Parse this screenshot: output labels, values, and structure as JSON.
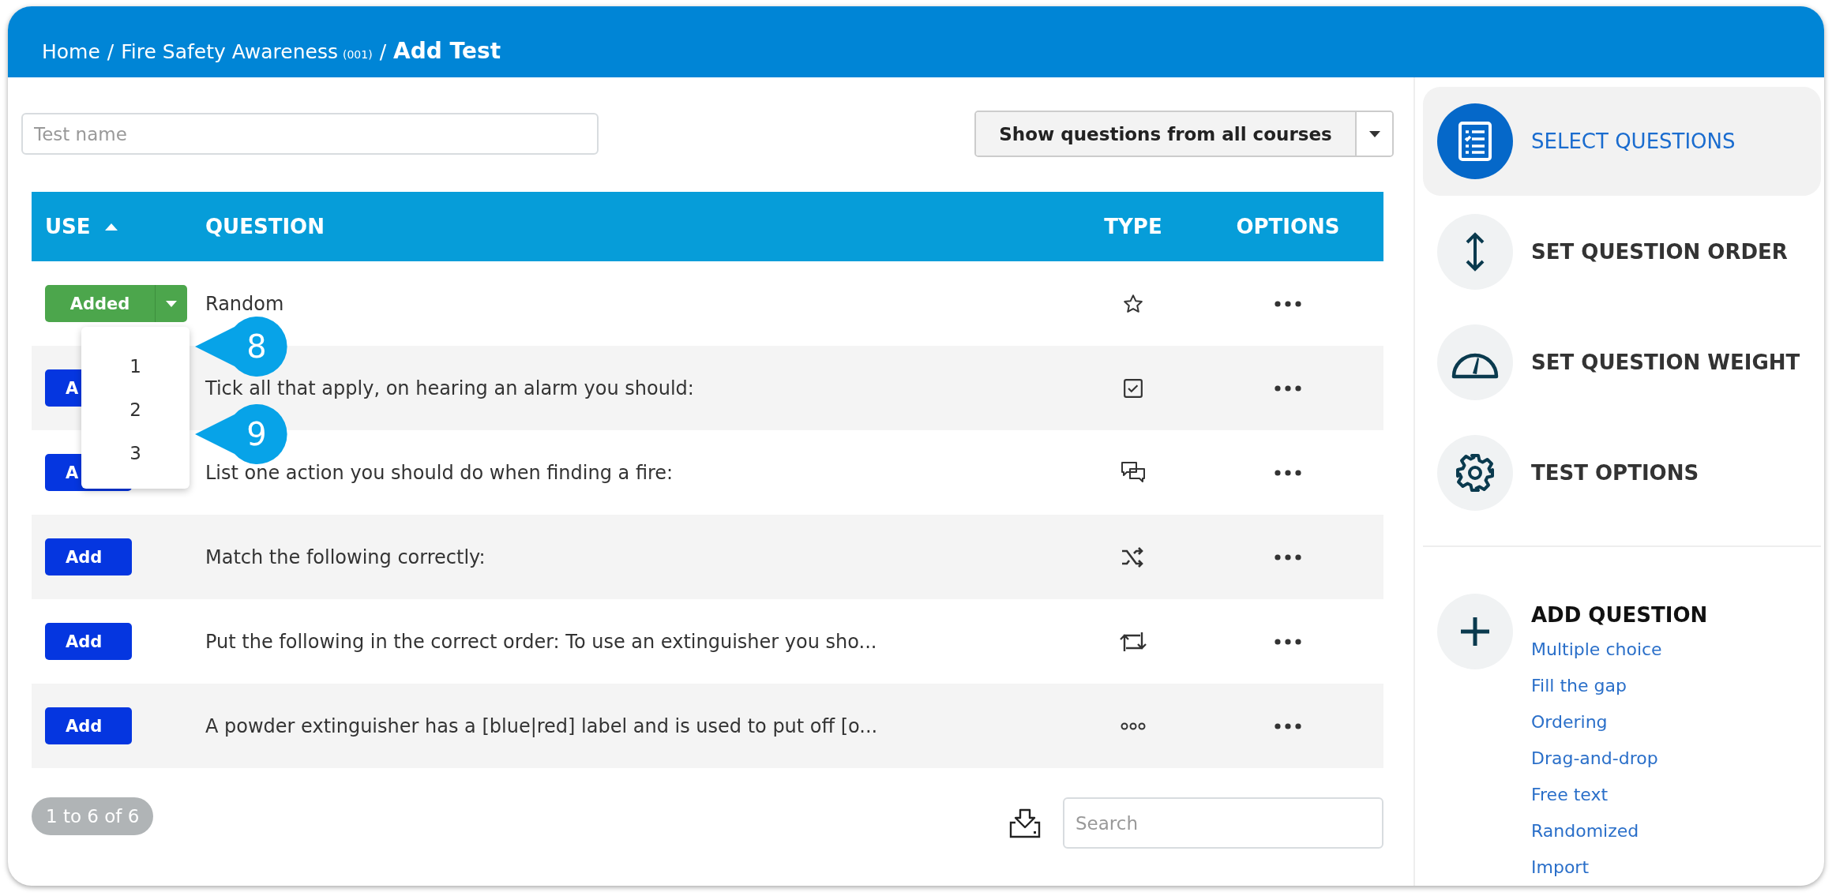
{
  "breadcrumb": [
    {
      "kind": "link",
      "text": "Home"
    },
    {
      "kind": "separator",
      "text": "/"
    },
    {
      "kind": "link",
      "text": "Fire Safety Awareness"
    },
    {
      "kind": "code",
      "text": "(001)"
    },
    {
      "kind": "separator",
      "text": "/"
    },
    {
      "kind": "current",
      "text": "Add Test"
    }
  ],
  "test_name": {
    "placeholder": "Test name"
  },
  "course_filter": {
    "label": "Show questions from all courses"
  },
  "table": {
    "columns": [
      {
        "label": "USE",
        "sorted": true
      },
      {
        "label": "QUESTION",
        "sorted": false
      },
      {
        "label": "TYPE",
        "sorted": false
      },
      {
        "label": "OPTIONS",
        "sorted": false
      }
    ],
    "rows": [
      {
        "use": "Added",
        "added": true,
        "question": "Random",
        "kind": "star"
      },
      {
        "use": "A",
        "added": false,
        "question": "Tick all that apply, on hearing an alarm you should:",
        "kind": "checkbox"
      },
      {
        "use": "A",
        "added": false,
        "question": "List one action you should do when finding a fire:",
        "kind": "chat"
      },
      {
        "use": "Add",
        "added": false,
        "question": "Match the following correctly:",
        "kind": "shuffle"
      },
      {
        "use": "Add",
        "added": false,
        "question": "Put the following in the correct order: To use an extinguisher you sho...",
        "kind": "repeat"
      },
      {
        "use": "Add",
        "added": false,
        "question": "A powder extinguisher has a [blue|red] label and is used to put off [o...",
        "kind": "dots"
      }
    ]
  },
  "use_menu": {
    "items": [
      "1",
      "2",
      "3"
    ]
  },
  "callouts": [
    "8",
    "9"
  ],
  "pager": "1 to 6 of 6",
  "search": {
    "placeholder": "Search"
  },
  "steps": [
    {
      "label": "SELECT QUESTIONS",
      "kind": "checklist",
      "selected": true
    },
    {
      "label": "SET QUESTION ORDER",
      "kind": "updown",
      "selected": false
    },
    {
      "label": "SET QUESTION WEIGHT",
      "kind": "gauge",
      "selected": false
    },
    {
      "label": "TEST OPTIONS",
      "kind": "gear",
      "selected": false
    }
  ],
  "add_question": {
    "title": "ADD QUESTION",
    "links": [
      "Multiple choice",
      "Fill the gap",
      "Ordering",
      "Drag-and-drop",
      "Free text",
      "Randomized",
      "Import"
    ]
  }
}
